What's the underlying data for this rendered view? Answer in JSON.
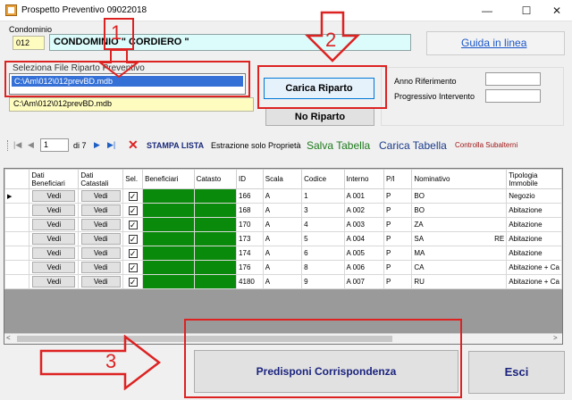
{
  "window": {
    "title": "Prospetto Preventivo 09022018",
    "minimize": "—",
    "maximize": "☐",
    "close": "✕"
  },
  "condominio": {
    "label": "Condominio",
    "code": "012",
    "name": "CONDOMINIO \" CORDIERO \""
  },
  "help_link": "Guida in linea",
  "file_select": {
    "label": "Seleziona File Riparto Preventivo",
    "selected": "C:\\Am\\012\\012prevBD.mdb",
    "path": "C:\\Am\\012\\012prevBD.mdb"
  },
  "buttons": {
    "carica": "Carica Riparto",
    "no_riparto": "No Riparto",
    "predisponi": "Predisponi Corrispondenza",
    "esci": "Esci"
  },
  "fields": {
    "anno_label": "Anno Riferimento",
    "progressivo_label": "Progressivo Intervento"
  },
  "navigator": {
    "page": "1",
    "of": "di 7"
  },
  "toolbar": {
    "stampa": "STAMPA LISTA",
    "estrazione": "Estrazione solo Proprietà",
    "salva": "Salva Tabella",
    "carica": "Carica Tabella",
    "controlla": "Controlla Subalterni"
  },
  "grid": {
    "headers": [
      "Dati Beneficiari",
      "Dati Catastali",
      "Sel.",
      "Beneficiari",
      "Catasto",
      "ID",
      "Scala",
      "Codice",
      "Interno",
      "P/I",
      "Nominativo",
      "Tipologia Immobile"
    ],
    "cell_button": "Vedi",
    "rows": [
      {
        "id": "166",
        "scala": "A",
        "codice": "1",
        "interno": "A 001",
        "pi": "P",
        "nominativo": "BO",
        "extra": "",
        "tipologia": "Negozio"
      },
      {
        "id": "168",
        "scala": "A",
        "codice": "3",
        "interno": "A 002",
        "pi": "P",
        "nominativo": "BO",
        "extra": "",
        "tipologia": "Abitazione"
      },
      {
        "id": "170",
        "scala": "A",
        "codice": "4",
        "interno": "A 003",
        "pi": "P",
        "nominativo": "ZA",
        "extra": "",
        "tipologia": "Abitazione"
      },
      {
        "id": "173",
        "scala": "A",
        "codice": "5",
        "interno": "A 004",
        "pi": "P",
        "nominativo": "SA",
        "extra": "RE",
        "tipologia": "Abitazione"
      },
      {
        "id": "174",
        "scala": "A",
        "codice": "6",
        "interno": "A 005",
        "pi": "P",
        "nominativo": "MA",
        "extra": "",
        "tipologia": "Abitazione"
      },
      {
        "id": "176",
        "scala": "A",
        "codice": "8",
        "interno": "A 006",
        "pi": "P",
        "nominativo": "CA",
        "extra": "",
        "tipologia": "Abitazione + Ca"
      },
      {
        "id": "4180",
        "scala": "A",
        "codice": "9",
        "interno": "A 007",
        "pi": "P",
        "nominativo": "RU",
        "extra": "",
        "tipologia": "Abitazione + Ca"
      }
    ]
  },
  "annotations": [
    "1",
    "2",
    "3"
  ],
  "colors": {
    "annotation": "#d22222",
    "selection": "#3470d6",
    "green_cell": "#0a8a0a",
    "link": "#1a56c8"
  }
}
